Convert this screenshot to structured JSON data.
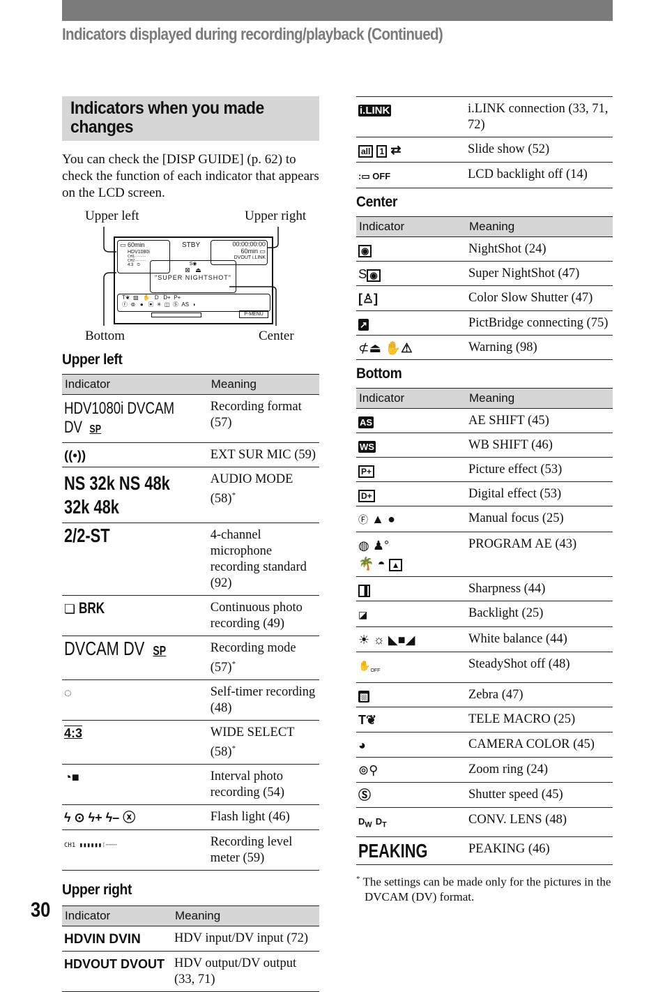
{
  "header": {
    "title": "Indicators displayed during recording/playback (Continued)"
  },
  "section": {
    "title": "Indicators when you made changes",
    "intro": "You can check the [DISP GUIDE] (p. 62) to check the function of each indicator that appears on the LCD screen."
  },
  "diagram": {
    "labels": {
      "upper_left": "Upper left",
      "upper_right": "Upper right",
      "bottom": "Bottom",
      "center": "Center"
    },
    "lcd": {
      "battery": "60min",
      "format": "HDV1080i",
      "ch1": "CH1",
      "ch2": "CH2",
      "aspect": "4:3",
      "status": "STBY",
      "timecode": "00:00:00:00",
      "tape": "60min",
      "dvout": "DVOUT",
      "ilink": "i.LINK",
      "center_s": "S",
      "message": "\"SUPER NIGHTSHOT\"",
      "pmenu": "P-MENU"
    }
  },
  "table_headers": {
    "indicator": "Indicator",
    "meaning": "Meaning"
  },
  "upper_left": {
    "title": "Upper left",
    "rows": [
      {
        "icons": [
          "HDV1080i",
          "DVCAM",
          "DV",
          "SP"
        ],
        "meaning": "Recording format (57)",
        "note": ""
      },
      {
        "icons": [
          "((•))"
        ],
        "meaning": "EXT SUR MIC (59)",
        "note": ""
      },
      {
        "icons": [
          "NS 32k",
          "NS 48k",
          "32k",
          "48k"
        ],
        "meaning": "AUDIO MODE (58)",
        "note": "*"
      },
      {
        "icons": [
          "2/2-ST"
        ],
        "meaning": "4-channel microphone recording standard (92)",
        "note": ""
      },
      {
        "icons": [
          "burst-icon",
          "BRK"
        ],
        "meaning": "Continuous photo recording (49)",
        "note": ""
      },
      {
        "icons": [
          "DVCAM",
          "DV",
          "SP"
        ],
        "meaning": "Recording mode (57)",
        "note": "*"
      },
      {
        "icons": [
          "self-timer-icon"
        ],
        "meaning": "Self-timer recording (48)",
        "note": ""
      },
      {
        "icons": [
          "4:3"
        ],
        "meaning": "WIDE SELECT (58)",
        "note": "*"
      },
      {
        "icons": [
          "interval-photo-icon"
        ],
        "meaning": "Interval photo recording (54)",
        "note": ""
      },
      {
        "icons": [
          "flash-icon",
          "red-eye-icon",
          "flash-plus-icon",
          "flash-minus-icon",
          "flash-off-icon"
        ],
        "meaning": "Flash light (46)",
        "note": ""
      },
      {
        "icons": [
          "level-meter-icon"
        ],
        "meaning": "Recording level meter (59)",
        "note": ""
      }
    ]
  },
  "upper_right": {
    "title": "Upper right",
    "rows": [
      {
        "icons": [
          "HDVIN",
          "DVIN"
        ],
        "meaning": "HDV input/DV input (72)"
      },
      {
        "icons": [
          "HDVOUT",
          "DVOUT"
        ],
        "meaning": "HDV output/DV output (33, 71)"
      },
      {
        "icons": [
          "i.LINK"
        ],
        "meaning": "i.LINK connection (33, 71, 72)"
      },
      {
        "icons": [
          "all",
          "1",
          "repeat-icon"
        ],
        "meaning": "Slide show (52)"
      },
      {
        "icons": [
          "lcd-backlight-off-icon"
        ],
        "meaning": "LCD backlight off (14)"
      }
    ]
  },
  "center": {
    "title": "Center",
    "rows": [
      {
        "icons": [
          "nightshot-icon"
        ],
        "meaning": "NightShot (24)"
      },
      {
        "icons": [
          "super-nightshot-icon"
        ],
        "meaning": "Super NightShot (47)"
      },
      {
        "icons": [
          "color-slow-shutter-icon"
        ],
        "meaning": "Color Slow Shutter (47)"
      },
      {
        "icons": [
          "pictbridge-icon"
        ],
        "meaning": "PictBridge connecting (75)"
      },
      {
        "icons": [
          "battery-warning-icon",
          "eject-icon",
          "camera-shake-warning-icon"
        ],
        "meaning": "Warning (98)"
      }
    ]
  },
  "bottom": {
    "title": "Bottom",
    "rows": [
      {
        "icons": [
          "AS"
        ],
        "meaning": "AE SHIFT (45)"
      },
      {
        "icons": [
          "WS"
        ],
        "meaning": "WB SHIFT (46)"
      },
      {
        "icons": [
          "P+"
        ],
        "meaning": "Picture effect (53)"
      },
      {
        "icons": [
          "D+"
        ],
        "meaning": "Digital effect (53)"
      },
      {
        "icons": [
          "manual-focus-icon",
          "infinity-icon",
          "person-icon"
        ],
        "meaning": "Manual focus (25)"
      },
      {
        "icons": [
          "spotlight-icon",
          "portrait-icon",
          "beach-icon",
          "sunset-icon",
          "landscape-icon"
        ],
        "meaning": "PROGRAM AE (43)"
      },
      {
        "icons": [
          "sharpness-icon"
        ],
        "meaning": "Sharpness (44)"
      },
      {
        "icons": [
          "backlight-icon"
        ],
        "meaning": "Backlight (25)"
      },
      {
        "icons": [
          "outdoor-icon",
          "indoor-icon",
          "one-push-icon"
        ],
        "meaning": "White balance (44)"
      },
      {
        "icons": [
          "steadyshot-off-icon"
        ],
        "meaning": "SteadyShot off (48)"
      },
      {
        "icons": [
          "zebra-icon"
        ],
        "meaning": "Zebra (47)"
      },
      {
        "icons": [
          "tele-macro-icon"
        ],
        "meaning": "TELE MACRO (25)"
      },
      {
        "icons": [
          "camera-color-icon"
        ],
        "meaning": "CAMERA COLOR (45)"
      },
      {
        "icons": [
          "zoom-ring-icon"
        ],
        "meaning": "Zoom ring (24)"
      },
      {
        "icons": [
          "shutter-speed-icon"
        ],
        "meaning": "Shutter speed (45)"
      },
      {
        "icons": [
          "conv-lens-wide-icon",
          "conv-lens-tele-icon"
        ],
        "meaning": "CONV. LENS (48)"
      },
      {
        "icons": [
          "PEAKING"
        ],
        "meaning": "PEAKING (46)"
      }
    ]
  },
  "footnote": {
    "mark": "*",
    "text": "The settings can be made only for the pictures in the DVCAM (DV) format."
  },
  "page_number": "30"
}
